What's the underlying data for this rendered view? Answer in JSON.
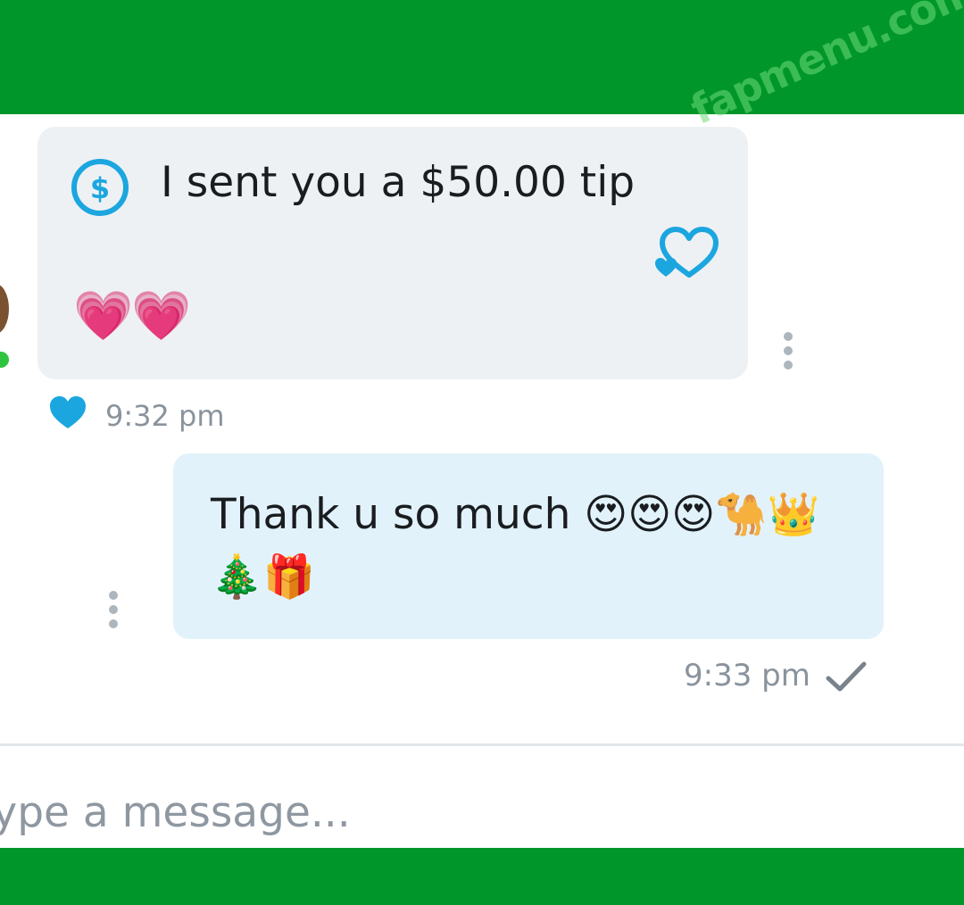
{
  "conversation": {
    "received_message": {
      "tip_text": "I sent you a $50.00 tip",
      "emojis": "💗💗",
      "time": "9:32 pm",
      "liked": true
    },
    "sent_message": {
      "text": "Thank u so much 😍😍😍🐪👑🎄🎁",
      "time": "9:33 pm",
      "status": "sent"
    }
  },
  "composer": {
    "placeholder": "Type a message..."
  },
  "watermark": "fapmenu.com",
  "colors": {
    "brand_green": "#00962a",
    "accent_blue": "#1ca6df",
    "received_bubble": "#eef1f4",
    "sent_bubble": "#e2f2fb"
  },
  "icons": [
    "dollar-icon",
    "like-outline-icon",
    "more-icon",
    "liked-heart-icon",
    "check-icon"
  ]
}
